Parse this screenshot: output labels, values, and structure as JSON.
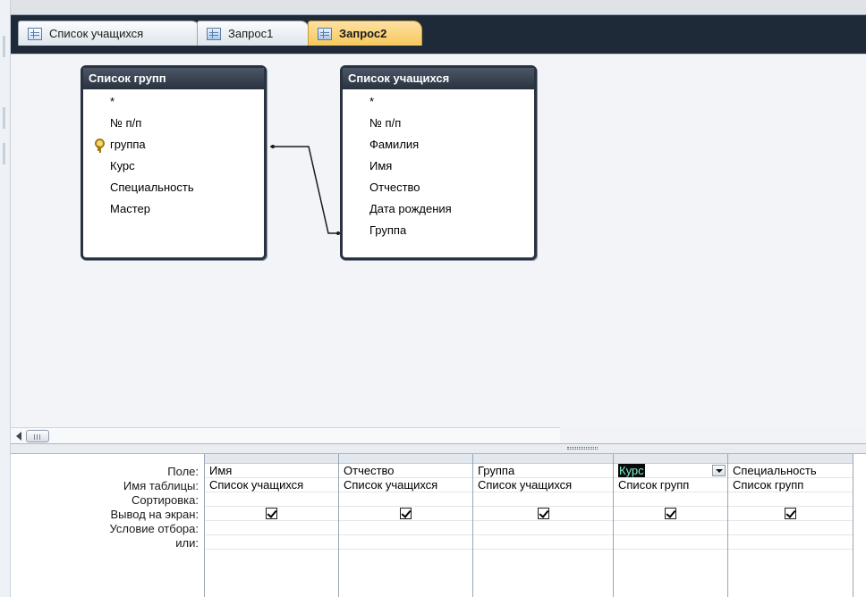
{
  "tabs": [
    {
      "label": "Список учащихся",
      "icon": "table-icon",
      "active": false
    },
    {
      "label": "Запрос1",
      "icon": "query-icon",
      "active": false
    },
    {
      "label": "Запрос2",
      "icon": "query-icon",
      "active": true
    }
  ],
  "tables": [
    {
      "title": "Список групп",
      "fields": [
        "*",
        "№ п/п",
        "группа",
        "Курс",
        "Специальность",
        "Мастер"
      ],
      "key_field": "группа"
    },
    {
      "title": "Список учащихся",
      "fields": [
        "*",
        "№ п/п",
        "Фамилия",
        "Имя",
        "Отчество",
        "Дата рождения",
        "Группа"
      ]
    }
  ],
  "grid": {
    "row_labels": [
      "Поле:",
      "Имя таблицы:",
      "Сортировка:",
      "Вывод на экран:",
      "Условие отбора:",
      "или:"
    ],
    "columns": [
      {
        "field": "Имя",
        "table": "Список учащихся",
        "sort": "",
        "show": true
      },
      {
        "field": "Отчество",
        "table": "Список учащихся",
        "sort": "",
        "show": true
      },
      {
        "field": "Группа",
        "table": "Список учащихся",
        "sort": "",
        "show": true
      },
      {
        "field": "Курс",
        "table": "Список групп",
        "sort": "",
        "show": true,
        "selected": true
      },
      {
        "field": "Специальность",
        "table": "Список групп",
        "sort": "",
        "show": true
      }
    ]
  },
  "colors": {
    "active_tab": "#f7c85b",
    "tab_bar": "#1f2a38",
    "table_header": "#2a3240"
  }
}
